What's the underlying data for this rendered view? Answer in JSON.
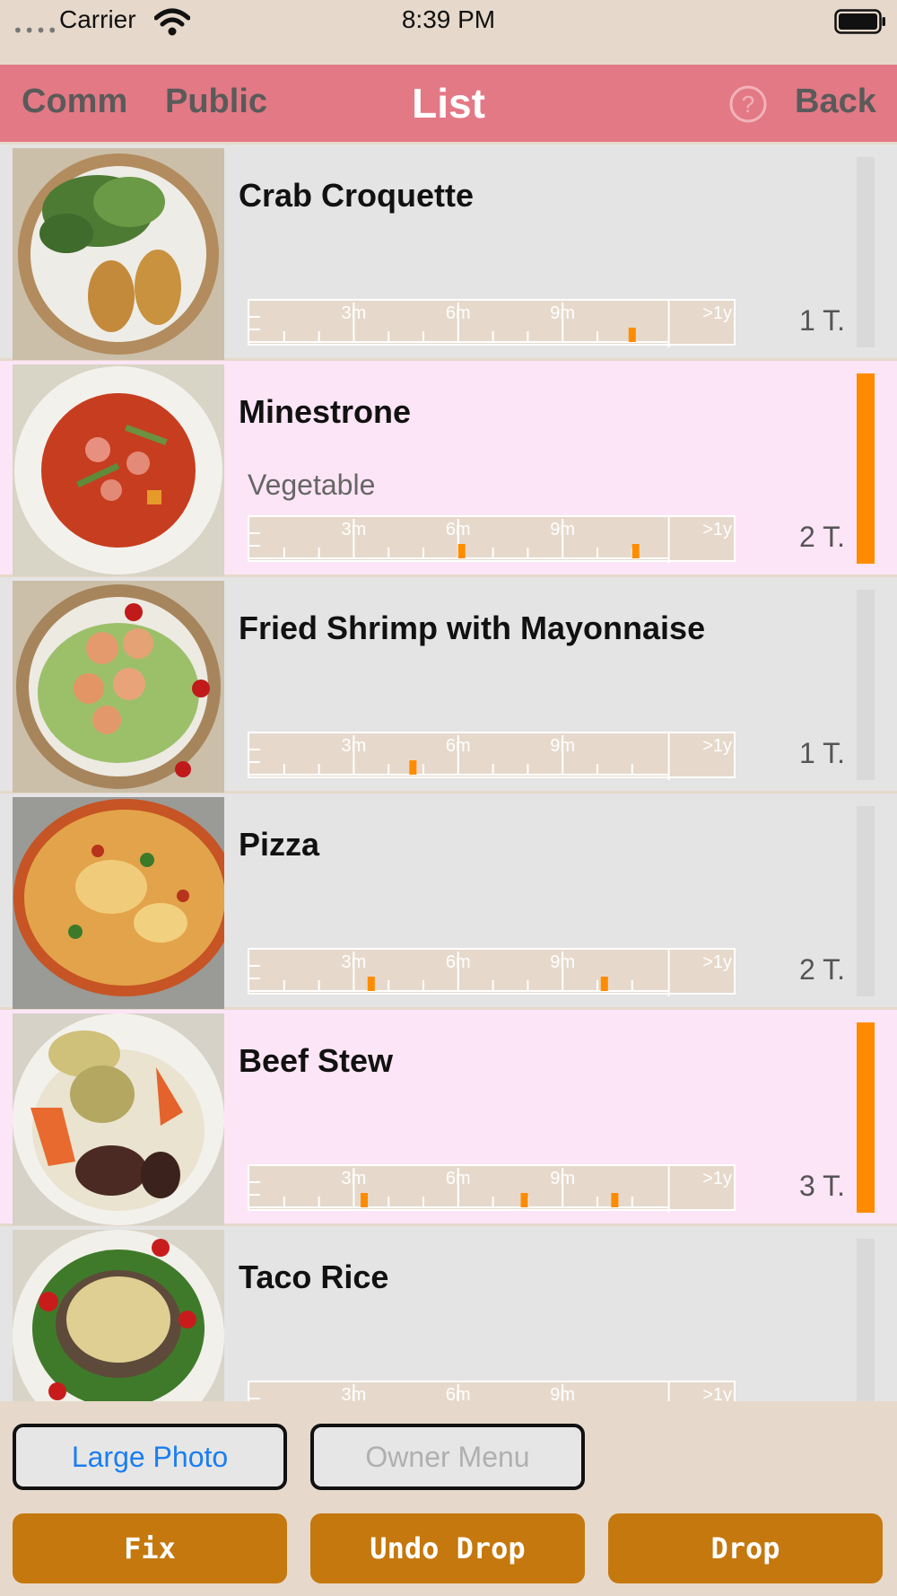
{
  "status_bar": {
    "signal": "••••",
    "carrier": "Carrier",
    "time": "8:39 PM",
    "wifi_icon": "wifi-icon",
    "battery_icon": "battery-icon"
  },
  "nav": {
    "left_1": "Comm",
    "left_2": "Public",
    "title": "List",
    "help_icon": "question-circle-icon",
    "back": "Back"
  },
  "timeline_labels": [
    "3m",
    "6m",
    "9m",
    ">1y"
  ],
  "colors": {
    "nav_bg": "#e37985",
    "beige": "#e6d9cb",
    "row_pink": "#fce5f6",
    "row_gray": "#e4e4e4",
    "accent_orange": "#ff8c00",
    "action_button": "#c5780e",
    "link_blue": "#1a7ef0"
  },
  "items": [
    {
      "title": "Crab Croquette",
      "subtitle": "",
      "count": "1 T.",
      "highlighted": false,
      "marks_months": [
        11.0
      ],
      "level": 0,
      "thumb": "croquette-photo"
    },
    {
      "title": "Minestrone",
      "subtitle": "Vegetable",
      "count": "2 T.",
      "highlighted": true,
      "marks_months": [
        6.1,
        11.1
      ],
      "level": 1,
      "thumb": "minestrone-photo"
    },
    {
      "title": "Fried Shrimp with Mayonnaise",
      "subtitle": "",
      "count": "1 T.",
      "highlighted": false,
      "marks_months": [
        4.7
      ],
      "level": 0,
      "thumb": "shrimp-salad-photo"
    },
    {
      "title": "Pizza",
      "subtitle": "",
      "count": "2 T.",
      "highlighted": false,
      "marks_months": [
        3.5,
        10.2
      ],
      "level": 0,
      "thumb": "pizza-photo"
    },
    {
      "title": "Beef Stew",
      "subtitle": "",
      "count": "3 T.",
      "highlighted": true,
      "marks_months": [
        3.3,
        7.9,
        10.5
      ],
      "level": 1,
      "thumb": "beef-stew-photo"
    },
    {
      "title": "Taco Rice",
      "subtitle": "",
      "count": "",
      "highlighted": false,
      "marks_months": [],
      "level": 0,
      "thumb": "taco-rice-photo"
    }
  ],
  "buttons": {
    "large_photo": "Large Photo",
    "owner_menu": "Owner Menu",
    "fix": "Fix",
    "undo_drop": "Undo Drop",
    "drop": "Drop"
  }
}
